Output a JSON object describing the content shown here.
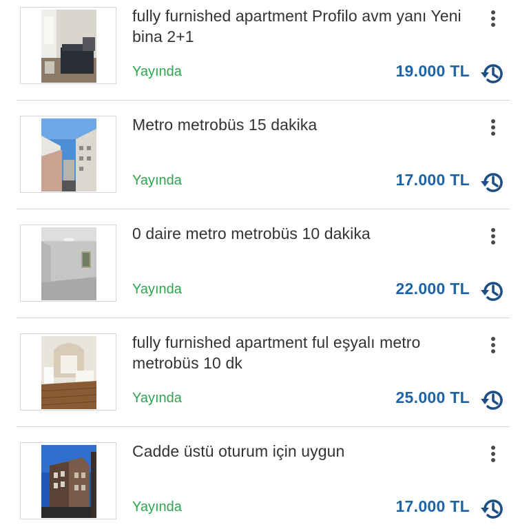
{
  "listings": [
    {
      "title": "fully furnished apartment Profilo avm yanı Yeni bina 2+1",
      "status": "Yayında",
      "price": "19.000 TL",
      "photo_icon": "bedroom-photo"
    },
    {
      "title": "Metro metrobüs 15 dakika",
      "status": "Yayında",
      "price": "17.000 TL",
      "photo_icon": "street-view-photo"
    },
    {
      "title": "0 daire metro metrobüs 10 dakika",
      "status": "Yayında",
      "price": "22.000 TL",
      "photo_icon": "empty-room-photo"
    },
    {
      "title": "fully furnished apartment ful eşyalı metro metrobüs 10 dk",
      "status": "Yayında",
      "price": "25.000 TL",
      "photo_icon": "furnished-room-photo"
    },
    {
      "title": "Cadde üstü oturum için uygun",
      "status": "Yayında",
      "price": "17.000 TL",
      "photo_icon": "building-exterior-photo"
    }
  ],
  "colors": {
    "status_green": "#2ea44f",
    "price_blue": "#1d63a8",
    "title_text": "#333333",
    "divider": "#d9d9d9"
  }
}
